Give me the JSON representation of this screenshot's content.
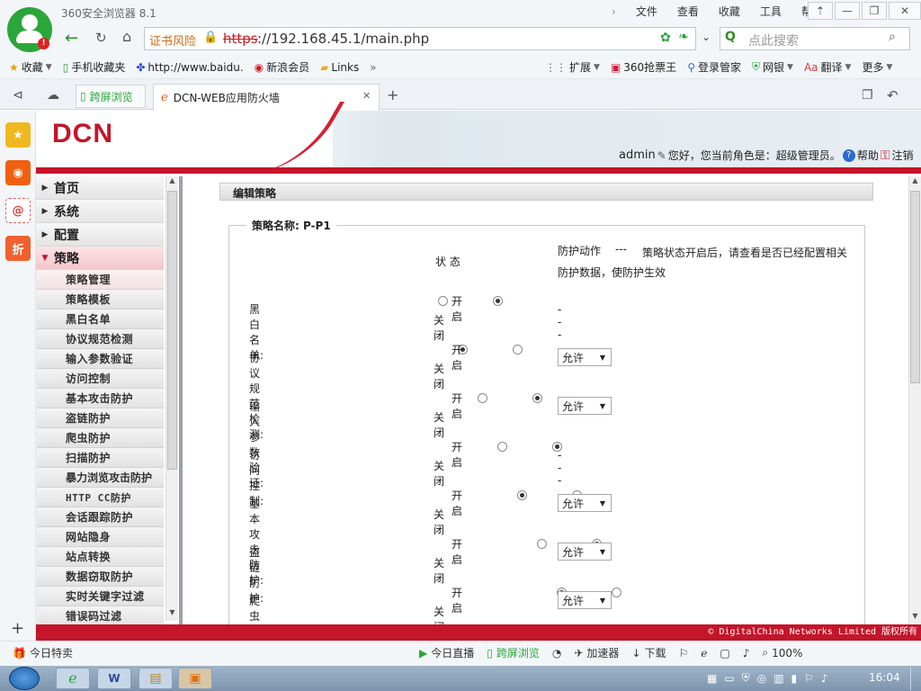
{
  "browser": {
    "title": "360安全浏览器 8.1",
    "menu": [
      "文件",
      "查看",
      "收藏",
      "工具",
      "帮助"
    ],
    "cert_warning": "证书风险",
    "url_prefix": "https",
    "url_rest": "://192.168.45.1/main.php",
    "search_placeholder": "点此搜索",
    "bookmarks": [
      "收藏",
      "手机收藏夹",
      "http://www.baidu.",
      "新浪会员",
      "Links"
    ],
    "right_tools": [
      "扩展",
      "360抢票王",
      "登录管家",
      "网银",
      "翻译",
      "更多"
    ],
    "tabs": {
      "split": "跨屏浏览",
      "active": "DCN-WEB应用防火墙"
    }
  },
  "header": {
    "brand": "DCN",
    "user": "admin",
    "greeting": "您好，您当前角色是：超级管理员。",
    "help": "帮助",
    "logout": "注销"
  },
  "menu": {
    "top": [
      {
        "label": "首页"
      },
      {
        "label": "系统"
      },
      {
        "label": "配置"
      },
      {
        "label": "策略"
      }
    ],
    "sub": [
      "策略管理",
      "策略模板",
      "黑白名单",
      "协议规范检测",
      "输入参数验证",
      "访问控制",
      "基本攻击防护",
      "盗链防护",
      "爬虫防护",
      "扫描防护",
      "暴力浏览攻击防护",
      "HTTP CC防护",
      "会话跟踪防护",
      "网站隐身",
      "站点转换",
      "数据窃取防护",
      "实时关键字过滤",
      "错误码过滤"
    ]
  },
  "content": {
    "panel_title": "编辑策略",
    "legend": "策略名称: P-P1",
    "col_status": "状 态",
    "col_action": "防护动作",
    "col_action_dash": "---",
    "note": "策略状态开启后，请查看是否已经配置相关防护数据，使防护生效",
    "open_label": "开启",
    "close_label": "关闭",
    "rows": [
      {
        "label": "黑白名单:",
        "enabled": false,
        "action": "---"
      },
      {
        "label": "协议规范检测:",
        "enabled": true,
        "action": "允许"
      },
      {
        "label": "输入参数验证:",
        "enabled": false,
        "action": "允许"
      },
      {
        "label": "访问控制:",
        "enabled": false,
        "action": "---"
      },
      {
        "label": "基本攻击防护:",
        "enabled": true,
        "action": "允许"
      },
      {
        "label": "盗链防护:",
        "enabled": false,
        "action": "允许"
      },
      {
        "label": "爬虫防护:",
        "enabled": true,
        "action": "允许"
      }
    ]
  },
  "footer": "© DigitalChina Networks Limited 版权所有",
  "statusbar": {
    "left": "今日特卖",
    "items": [
      "今日直播",
      "跨屏浏览",
      "加速器",
      "下载"
    ],
    "zoom": "100%"
  },
  "taskbar": {
    "time": "16:04"
  }
}
